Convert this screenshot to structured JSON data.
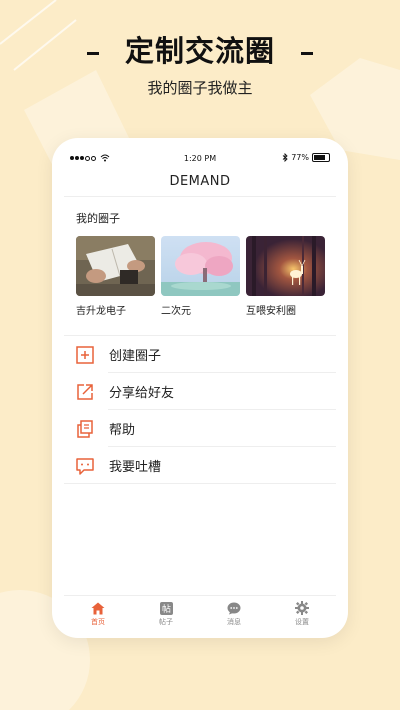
{
  "promo": {
    "title": "定制交流圈",
    "subtitle": "我的圈子我做主"
  },
  "statusbar": {
    "time": "1:20 PM",
    "battery": "77%",
    "battery_level": 0.77
  },
  "app": {
    "title": "DEMAND"
  },
  "my_circles": {
    "title": "我的圈子",
    "items": [
      {
        "name": "吉升龙电子",
        "image": "hands-and-notebook-photo"
      },
      {
        "name": "二次元",
        "image": "pink-blossom-tree-illustration"
      },
      {
        "name": "互喂安利圈",
        "image": "glowing-deer-in-forest"
      }
    ]
  },
  "menu": [
    {
      "label": "创建圈子",
      "icon": "plus-square-icon"
    },
    {
      "label": "分享给好友",
      "icon": "share-arrow-icon"
    },
    {
      "label": "帮助",
      "icon": "help-doc-icon"
    },
    {
      "label": "我要吐槽",
      "icon": "feedback-bubble-icon"
    }
  ],
  "tabbar": {
    "items": [
      {
        "label": "首页",
        "icon": "home-icon",
        "active": true
      },
      {
        "label": "帖子",
        "icon": "post-icon",
        "glyph": "帖",
        "active": false
      },
      {
        "label": "消息",
        "icon": "message-icon",
        "active": false
      },
      {
        "label": "设置",
        "icon": "settings-gear-icon",
        "active": false
      }
    ]
  },
  "colors": {
    "background": "#fcecc8",
    "accent": "#e8623a",
    "inactive": "#888888"
  }
}
